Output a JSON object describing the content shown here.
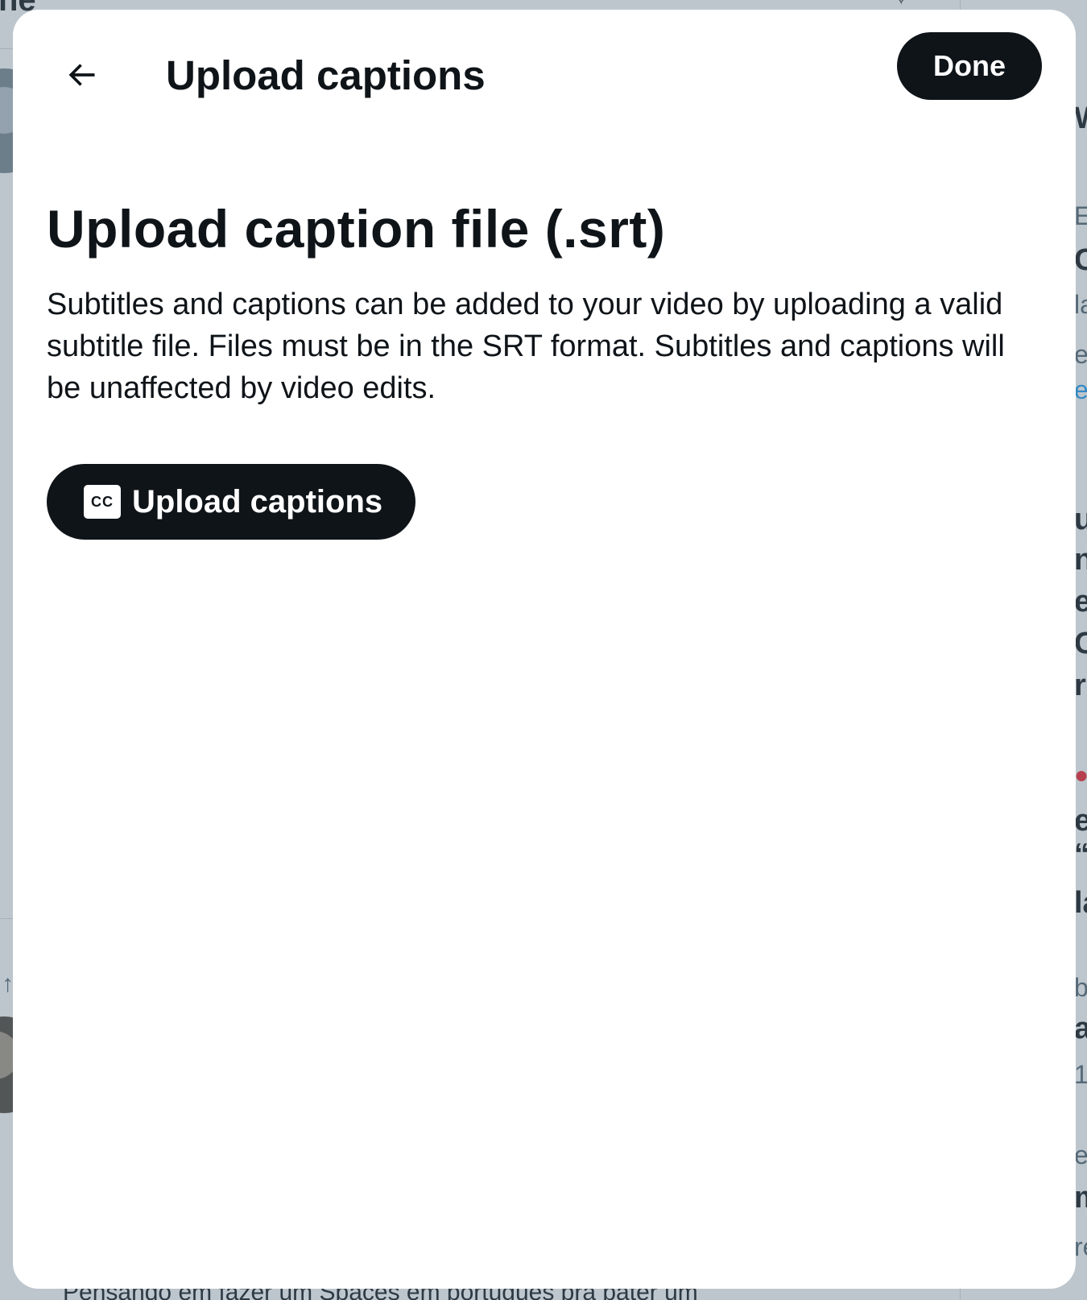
{
  "background": {
    "header_fragment": "ne",
    "bottom_text": "Pensando em fazer um Spaces em português pra bater um",
    "right_column_fragments": [
      "W",
      "E",
      "C",
      "la",
      "e",
      "ea",
      "u",
      "n",
      "e",
      "C",
      "ri",
      "e",
      "“",
      "la",
      "bl",
      "a",
      "1",
      "e",
      "m",
      "re"
    ]
  },
  "modal": {
    "title": "Upload captions",
    "done_label": "Done",
    "section_heading": "Upload caption file (.srt)",
    "description": "Subtitles and captions can be added to your video by uploading a valid subtitle file. Files must be in the SRT format. Subtitles and captions will be unaffected by video edits.",
    "upload_button": {
      "icon": "closed-captions-icon",
      "icon_text": "CC",
      "label": "Upload captions"
    }
  },
  "colors": {
    "primary_dark": "#0f1419",
    "modal_background": "#ffffff",
    "overlay": "rgba(91, 112, 131, 0.4)",
    "link": "#1d9bf0"
  }
}
